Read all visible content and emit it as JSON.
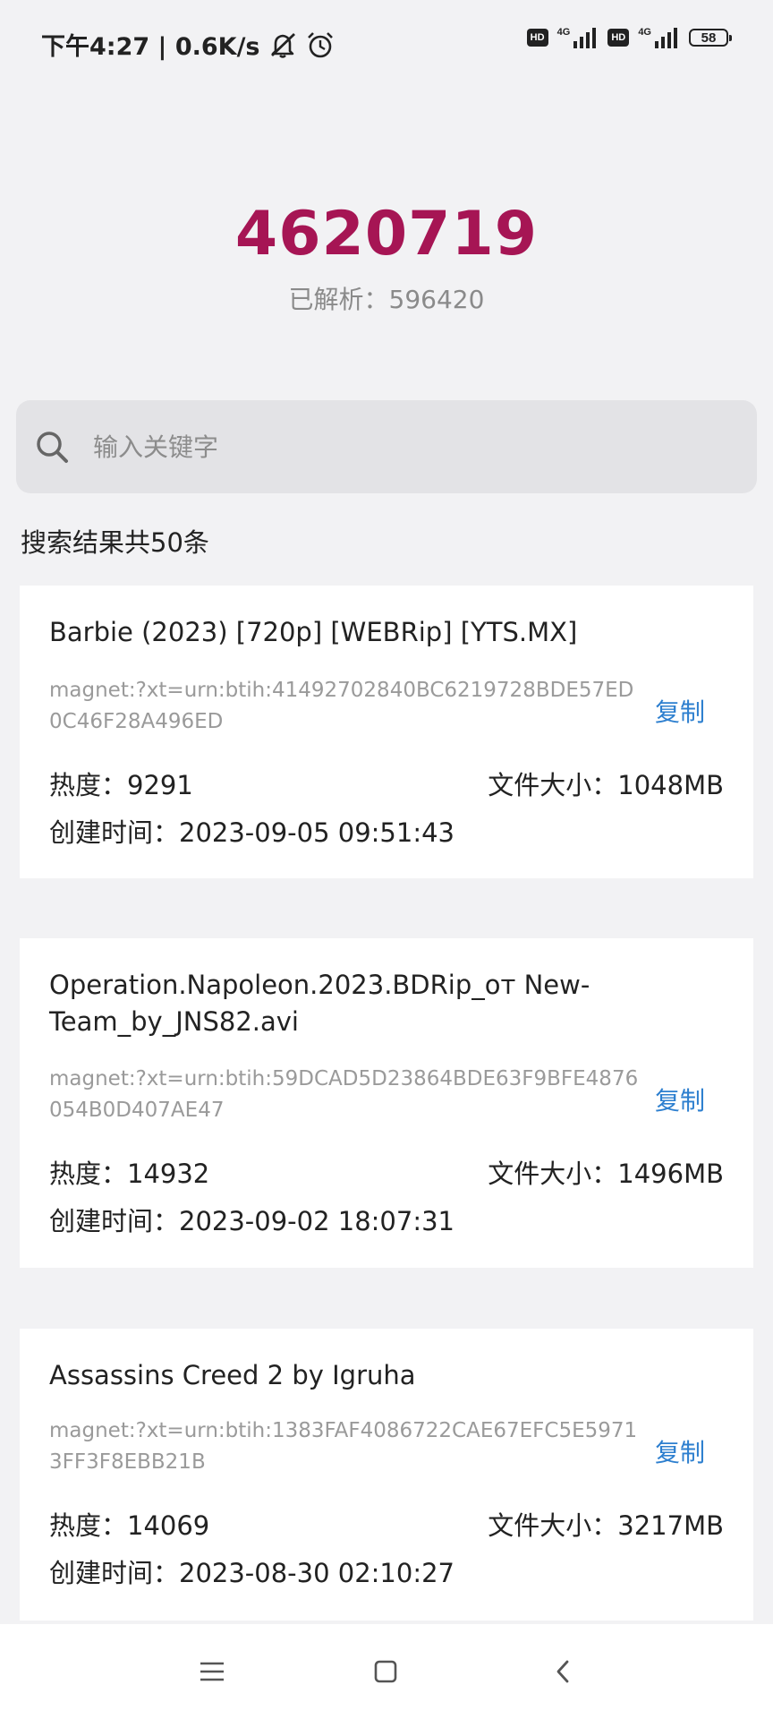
{
  "status_bar": {
    "time_speed": "下午4:27 | 0.6K/s",
    "network_1": "4G",
    "network_2": "4G",
    "hd_label": "HD",
    "battery": "58",
    "icons": [
      "mute-icon",
      "alarm-icon",
      "hd-icon",
      "signal-icon",
      "battery-icon"
    ]
  },
  "stats": {
    "total": "4620719",
    "parsed": "已解析：596420"
  },
  "search": {
    "placeholder": "输入关键字",
    "value": ""
  },
  "result_summary": "搜索结果共50条",
  "results": [
    {
      "title": "Barbie (2023) [720p] [WEBRip] [YTS.MX]",
      "magnet": "magnet:?xt=urn:btih:41492702840BC6219728BDE57ED0C46F28A496ED",
      "copy_label": "复制",
      "heat": "热度：9291",
      "size": "文件大小：1048MB",
      "created": "创建时间：2023-09-05 09:51:43"
    },
    {
      "title": "Operation.Napoleon.2023.BDRip_от New-Team_by_JNS82.avi",
      "magnet": "magnet:?xt=urn:btih:59DCAD5D23864BDE63F9BFE4876054B0D407AE47",
      "copy_label": "复制",
      "heat": "热度：14932",
      "size": "文件大小：1496MB",
      "created": "创建时间：2023-09-02 18:07:31"
    },
    {
      "title": "Assassins Creed 2 by Igruha",
      "magnet": "magnet:?xt=urn:btih:1383FAF4086722CAE67EFC5E59713FF3F8EBB21B",
      "copy_label": "复制",
      "heat": "热度：14069",
      "size": "文件大小：3217MB",
      "created": "创建时间：2023-08-30 02:10:27"
    }
  ],
  "colors": {
    "accent": "#a61554",
    "link": "#2d7fcf",
    "background": "#f2f2f4"
  },
  "nav": {
    "icons": [
      "menu-icon",
      "home-icon",
      "back-icon"
    ]
  }
}
